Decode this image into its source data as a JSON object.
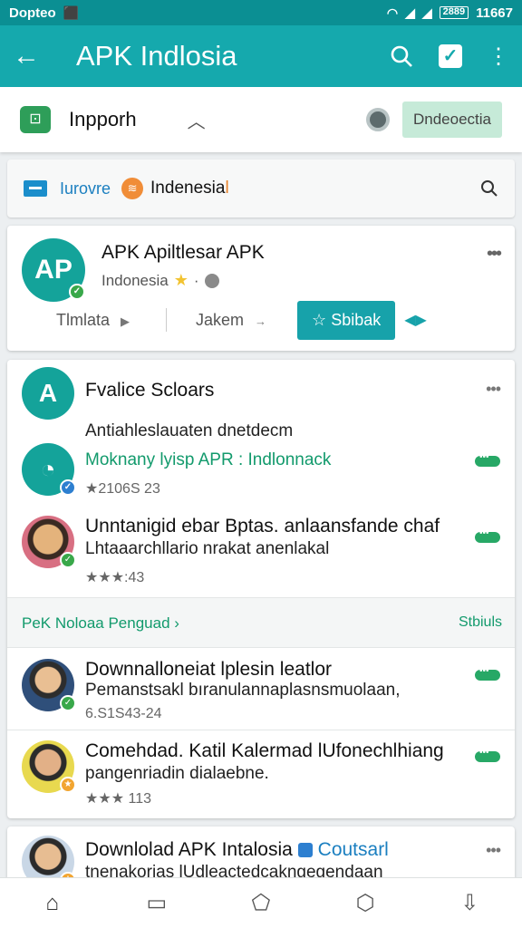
{
  "status_bar": {
    "left_text": "Dopteo",
    "battery": "2889",
    "time": "11667"
  },
  "app_bar": {
    "title": "APK Indlosia"
  },
  "filter_bar": {
    "label": "Inpporh",
    "language_button": "Dndeoectia"
  },
  "search_bar": {
    "text1": "Iurovre",
    "text2": "Indenesia",
    "text2_suffix": "l"
  },
  "hero": {
    "logo_text": "AP",
    "title": "APK Apiltlesar APK",
    "subtitle": "Indonesia",
    "tab1": "Tlmlata",
    "tab2": "Jakem",
    "primary_button": "Sbibak"
  },
  "list_items": [
    {
      "title": "Fvalice Scloars",
      "line": "Antiahleslauaten dnetdecm"
    },
    {
      "green_title": "Moknany lyisp APR : Indlonnack",
      "meta": "★2106S 23"
    },
    {
      "title": "Unntanigid ebar Bptas. anlaansfande chaf",
      "line": "Lhtaaarchllario nrakat anenlakal",
      "meta": "★★★:43"
    }
  ],
  "section_header": {
    "left": "PeK Noloaa Penguad ›",
    "right": "Stbiuls"
  },
  "list2_items": [
    {
      "title": "Downnalloneiat lplesin leatlor",
      "line": "Pemanstsakl bıranulannaplasnsmuolaan,",
      "meta": "6.S1S43-24"
    },
    {
      "title": "Comehdad. Katil Kalermad lUfonechlhiang",
      "line": "pangenriadin dialaebne.",
      "meta": "★★★ 113"
    }
  ],
  "bottom_card": {
    "title": "Downlolad APK Intalosia",
    "blue_text": "Coutsarl",
    "line": "tnenakorias lUdleactedcakngegendaan"
  },
  "colors": {
    "primary": "#15a9ad",
    "status": "#0b8f93",
    "accent_green": "#129a6c"
  }
}
